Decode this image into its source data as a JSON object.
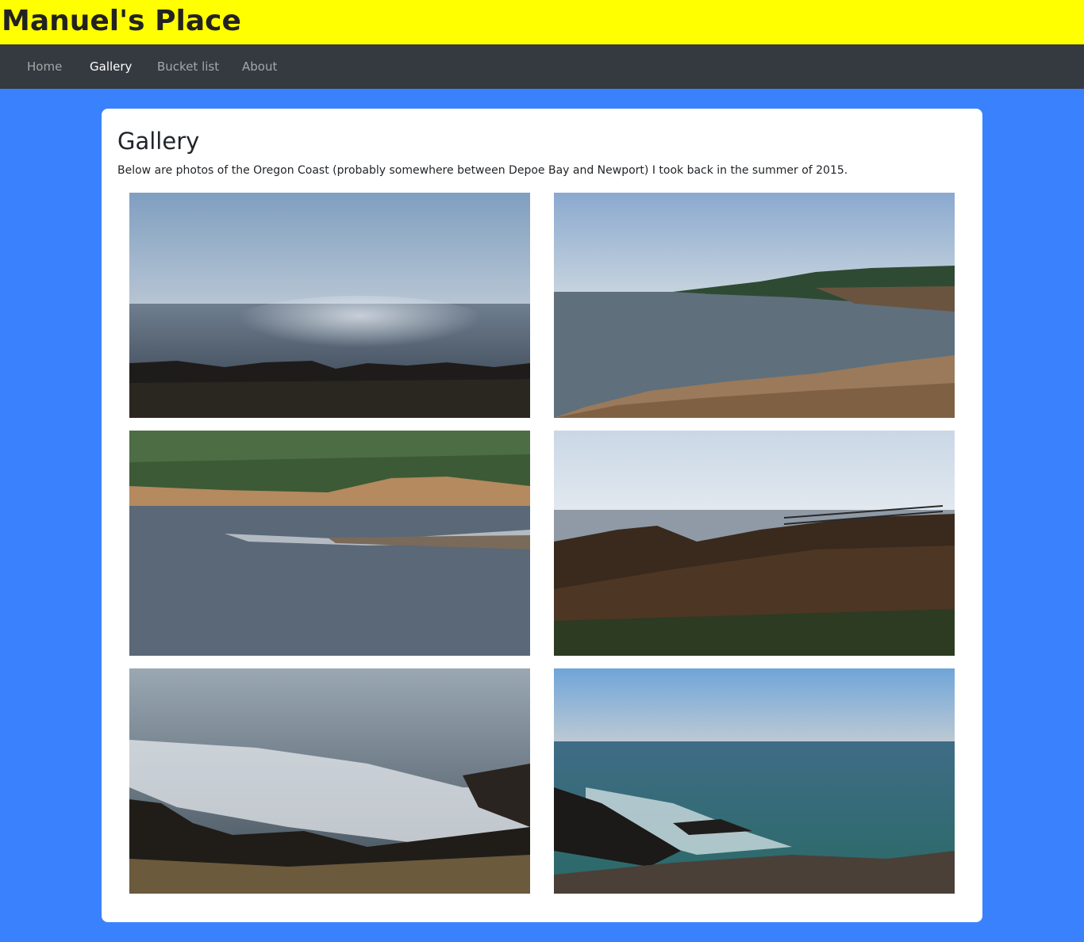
{
  "header": {
    "site_title": "Manuel's Place"
  },
  "nav": {
    "items": [
      {
        "label": "Home",
        "active": false
      },
      {
        "label": "Gallery",
        "active": true
      },
      {
        "label": "Bucket list",
        "active": false
      },
      {
        "label": "About",
        "active": false
      }
    ]
  },
  "main": {
    "title": "Gallery",
    "description": "Below are photos of the Oregon Coast (probably somewhere between Depoe Bay and Newport) I took back in the summer of 2015."
  },
  "colors": {
    "page_background": "#3a82fd",
    "header_background": "#ffff00",
    "navbar_background": "#343a40"
  }
}
